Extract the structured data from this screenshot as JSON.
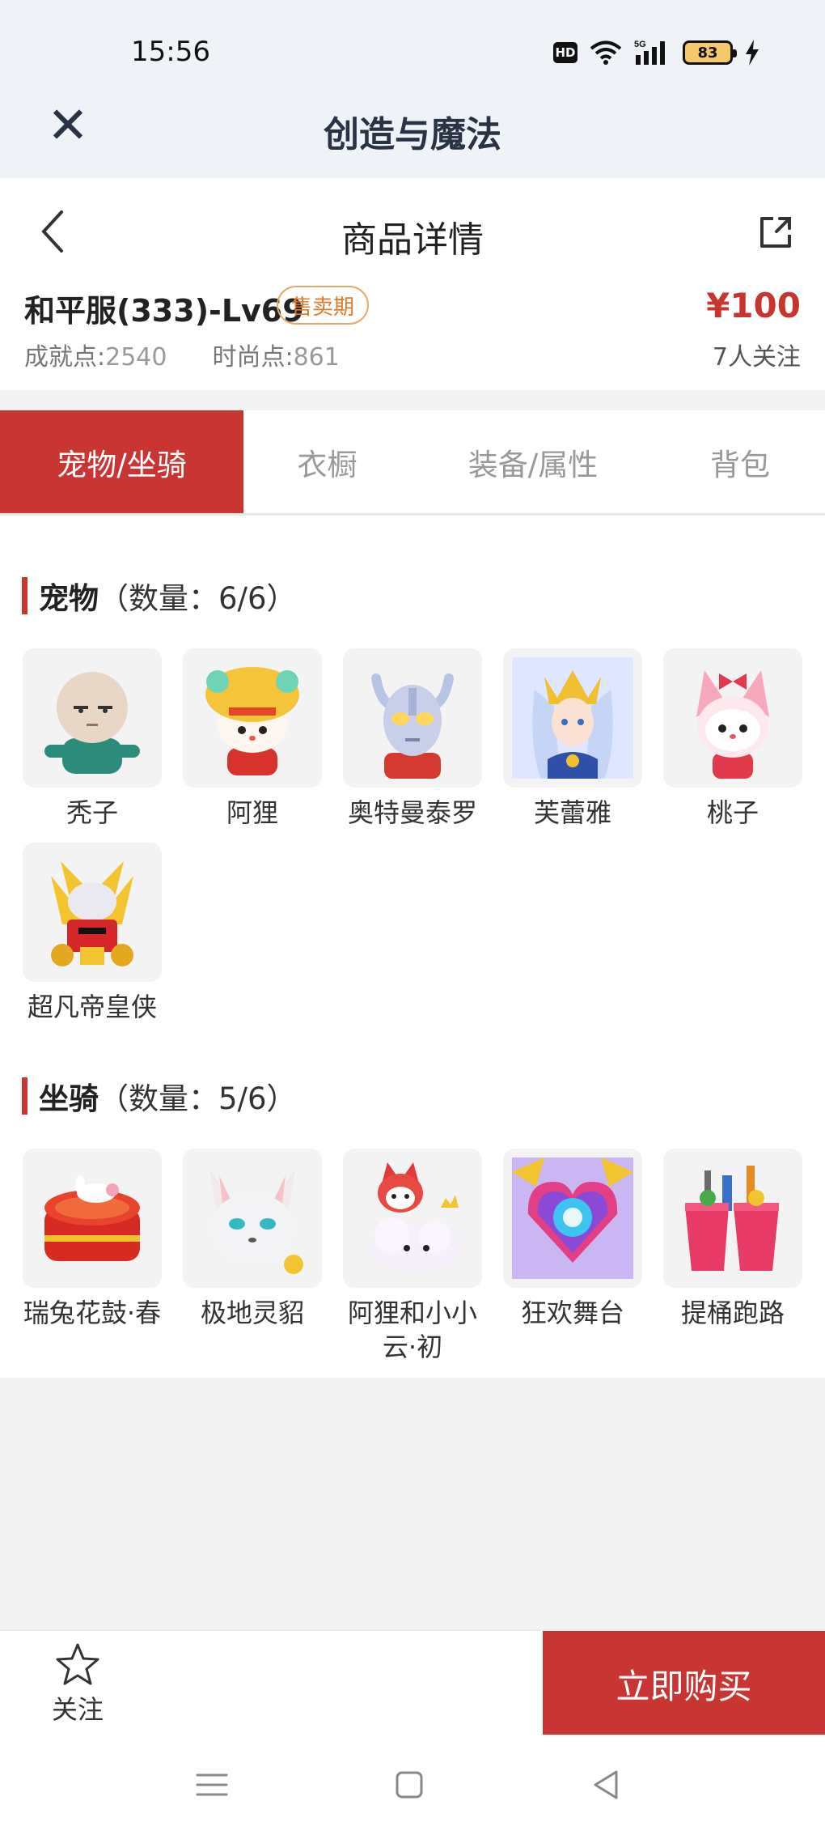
{
  "status_bar": {
    "time": "15:56",
    "hd": "HD",
    "network": "5G",
    "battery": "83"
  },
  "window": {
    "title": "创造与魔法"
  },
  "nav": {
    "title": "商品详情"
  },
  "product": {
    "name": "和平服(333)-Lv69",
    "badge": "售卖期",
    "price": "¥100",
    "achievement_label": "成就点:",
    "achievement_value": "2540",
    "fashion_label": "时尚点:",
    "fashion_value": "861",
    "followers": "7人关注"
  },
  "tabs": [
    {
      "label": "宠物/坐骑",
      "active": true
    },
    {
      "label": "衣橱",
      "active": false
    },
    {
      "label": "装备/属性",
      "active": false
    },
    {
      "label": "背包",
      "active": false
    }
  ],
  "pets": {
    "title": "宠物",
    "count": "（数量：6/6）",
    "items": [
      {
        "name": "秃子",
        "icon": "bald-boy-pet-icon"
      },
      {
        "name": "阿狸",
        "icon": "ali-lion-pet-icon"
      },
      {
        "name": "奥特曼泰罗",
        "icon": "ultraman-taro-pet-icon"
      },
      {
        "name": "芙蕾雅",
        "icon": "freya-pet-icon"
      },
      {
        "name": "桃子",
        "icon": "peach-pet-icon"
      },
      {
        "name": "超凡帝皇侠",
        "icon": "emperor-knight-pet-icon"
      }
    ]
  },
  "mounts": {
    "title": "坐骑",
    "count": "（数量：5/6）",
    "items": [
      {
        "name": "瑞兔花鼓·春",
        "icon": "rabbit-drum-mount-icon"
      },
      {
        "name": "极地灵貂",
        "icon": "polar-mink-mount-icon"
      },
      {
        "name": "阿狸和小小云·初",
        "icon": "ali-cloud-mount-icon"
      },
      {
        "name": "狂欢舞台",
        "icon": "carnival-stage-mount-icon"
      },
      {
        "name": "提桶跑路",
        "icon": "bucket-run-mount-icon"
      }
    ]
  },
  "bottom": {
    "follow_label": "关注",
    "buy_label": "立即购买"
  },
  "colors": {
    "accent": "#c83532",
    "badge": "#e07a2b",
    "price": "#c73531"
  }
}
